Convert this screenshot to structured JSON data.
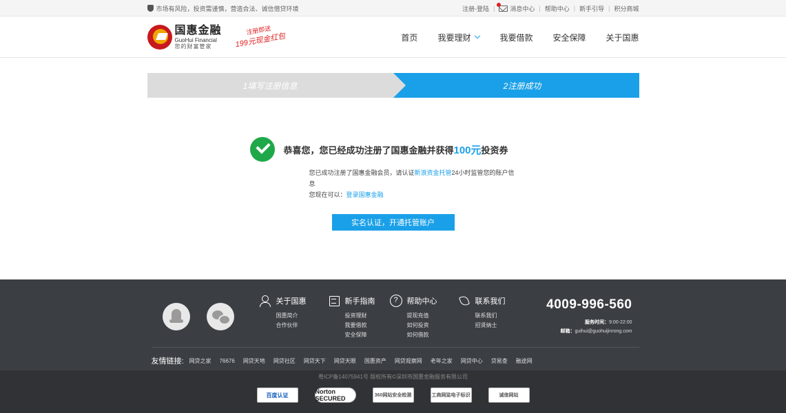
{
  "topbar": {
    "notice": "市场有风险，投资需谨慎，营造合法、诚信借贷环境",
    "register_login": "注册-登陆",
    "messages": "消息中心",
    "help": "帮助中心",
    "newbie": "新手引导",
    "points": "积分商城"
  },
  "header": {
    "logo_cn": "国惠金融",
    "logo_en": "GuoHui Financial",
    "logo_slogan": "您的财富管家",
    "promo_line1": "注册即送",
    "promo_line2": "199元现金红包",
    "nav": {
      "home": "首页",
      "invest": "我要理财",
      "borrow": "我要借款",
      "security": "安全保障",
      "about": "关于国惠"
    }
  },
  "steps": {
    "step1": "1填写注册信息",
    "step2": "2注册成功"
  },
  "success": {
    "msg_prefix": "恭喜您，您已经成功注册了国惠金融并获得",
    "amount": "100元",
    "msg_suffix": "投资券",
    "line1_prefix": "您已成功注册了国惠金融会员，请认证",
    "line1_link": "新浪资金托管",
    "line1_suffix": "24小时监管您的账户信息",
    "line2_prefix": "您现在可以：",
    "line2_link": "登录国惠金融",
    "button": "实名认证，开通托管账户"
  },
  "footer": {
    "cols": [
      {
        "title": "关于国惠",
        "items": [
          "国惠简介",
          "合作伙伴"
        ]
      },
      {
        "title": "新手指南",
        "items": [
          "投资理财",
          "我要借款",
          "安全保障"
        ]
      },
      {
        "title": "帮助中心",
        "items": [
          "提现充值",
          "如何投资",
          "如何借款"
        ]
      },
      {
        "title": "联系我们",
        "items": [
          "联系我们",
          "招贤纳士"
        ]
      }
    ],
    "hotline": "4009-996-560",
    "service_label": "服务时间：",
    "service_time": "9:00-22:00",
    "email_label": "邮箱：",
    "email": "guihui@guohuijinrong.com",
    "links_label": "友情链接:",
    "links": [
      "网贷之家",
      "76676",
      "网贷天地",
      "网贷社区",
      "网贷天下",
      "网贷天眼",
      "国惠资产",
      "网贷观察网",
      "老年之家",
      "网贷中心",
      "贷易查",
      "融途网"
    ],
    "copyright": "粤ICP备14075941号 版权所有©深圳市国惠金融服务有限公司",
    "badges": [
      "百度认证",
      "Norton SECURED",
      "360网站安全检测",
      "工商网监电子标识",
      "诚信网站"
    ]
  }
}
